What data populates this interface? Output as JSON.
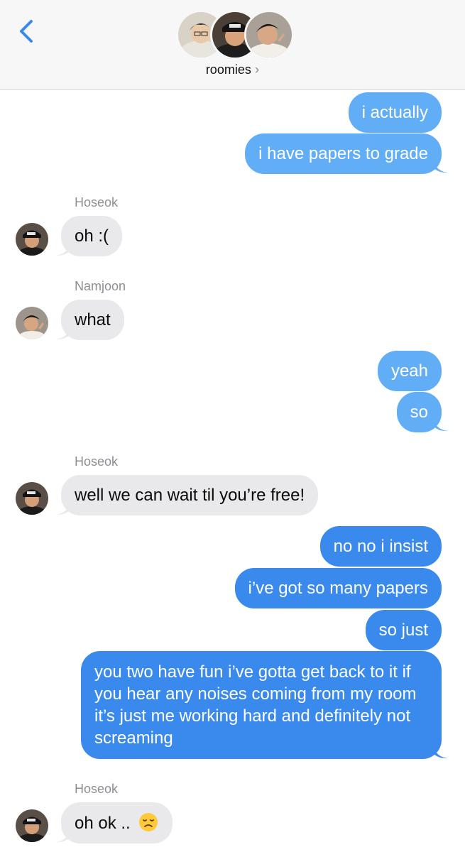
{
  "header": {
    "title": "roomies",
    "chevron": "›",
    "participants": [
      "avatar-1",
      "avatar-2",
      "avatar-3"
    ]
  },
  "messages": {
    "m1": "i actually",
    "m2": "i have papers to grade",
    "hoseok_1": "Hoseok",
    "m3": "oh :(",
    "namjoon_1": "Namjoon",
    "m4": "what",
    "m5": "yeah",
    "m6": "so",
    "hoseok_2": "Hoseok",
    "m7": "well we can wait til you’re free!",
    "m8": "no no i insist",
    "m9": "i’ve got so many papers",
    "m10": "so just",
    "m11": "you two have fun i’ve gotta get back to it if you hear any noises coming from my room it’s just me working hard and definitely not screaming",
    "hoseok_3": "Hoseok",
    "m12": "oh ok .."
  },
  "colors": {
    "outgoing_light": "#62aef6",
    "outgoing_dark": "#3a89ec",
    "incoming": "#e9e9eb",
    "accent": "#3a89ec"
  },
  "icons": {
    "back": "chevron-left-icon",
    "emoji": "disappointed-face-emoji"
  }
}
